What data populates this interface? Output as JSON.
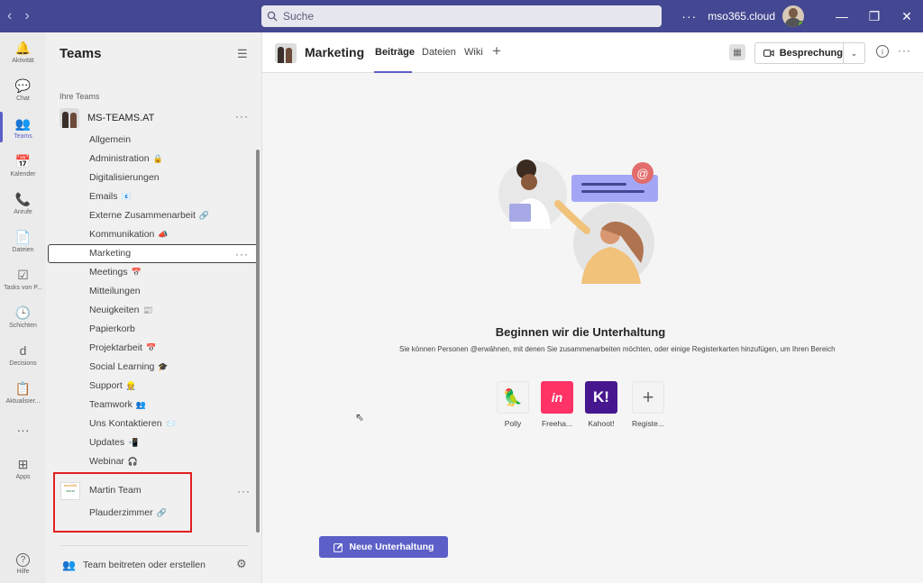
{
  "titlebar": {
    "search_placeholder": "Suche",
    "more": "···",
    "tenant": "mso365.cloud",
    "minimize": "—",
    "maximize": "❐",
    "close": "✕"
  },
  "apprail": {
    "items": [
      {
        "label": "Aktivität",
        "icon": "bell-icon",
        "glyph": "🔔"
      },
      {
        "label": "Chat",
        "icon": "chat-icon",
        "glyph": "💬"
      },
      {
        "label": "Teams",
        "icon": "teams-icon",
        "glyph": "👥"
      },
      {
        "label": "Kalender",
        "icon": "calendar-icon",
        "glyph": "📅"
      },
      {
        "label": "Anrufe",
        "icon": "phone-icon",
        "glyph": "📞"
      },
      {
        "label": "Dateien",
        "icon": "file-icon",
        "glyph": "📄"
      },
      {
        "label": "Tasks von P...",
        "icon": "tasks-icon",
        "glyph": "☑"
      },
      {
        "label": "Schichten",
        "icon": "clock-icon",
        "glyph": "🕒"
      },
      {
        "label": "Decisions",
        "icon": "decisions-icon",
        "glyph": "d"
      },
      {
        "label": "Aktualisier...",
        "icon": "updates-icon",
        "glyph": "📋"
      },
      {
        "label": "",
        "icon": "more-apps-icon",
        "glyph": "···"
      },
      {
        "label": "Apps",
        "icon": "apps-icon",
        "glyph": "⊞"
      },
      {
        "label": "Hilfe",
        "icon": "help-icon",
        "glyph": "?"
      }
    ]
  },
  "sidebar": {
    "title": "Teams",
    "section_label": "Ihre Teams",
    "team1": {
      "name": "MS-TEAMS.AT",
      "channels": [
        {
          "name": "Allgemein",
          "emoji": ""
        },
        {
          "name": "Administration",
          "emoji": "🔒"
        },
        {
          "name": "Digitalisierungen",
          "emoji": ""
        },
        {
          "name": "Emails",
          "emoji": "📧"
        },
        {
          "name": "Externe Zusammenarbeit",
          "emoji": "🔗"
        },
        {
          "name": "Kommunikation",
          "emoji": "📣"
        },
        {
          "name": "Marketing",
          "emoji": ""
        },
        {
          "name": "Meetings",
          "emoji": "📅"
        },
        {
          "name": "Mitteilungen",
          "emoji": ""
        },
        {
          "name": "Neuigkeiten",
          "emoji": "📰"
        },
        {
          "name": "Papierkorb",
          "emoji": ""
        },
        {
          "name": "Projektarbeit",
          "emoji": "📅"
        },
        {
          "name": "Social Learning",
          "emoji": "🎓"
        },
        {
          "name": "Support",
          "emoji": "👷"
        },
        {
          "name": "Teamwork",
          "emoji": "👥"
        },
        {
          "name": "Uns Kontaktieren",
          "emoji": "📨"
        },
        {
          "name": "Updates",
          "emoji": "📲"
        },
        {
          "name": "Webinar",
          "emoji": "🎧"
        }
      ]
    },
    "team2": {
      "name": "Martin Team",
      "avatar_line1": "mso365",
      "avatar_line2": "cloud",
      "channels": [
        {
          "name": "Plauderzimmer",
          "emoji": "🔗"
        }
      ]
    },
    "join_label": "Team beitreten oder erstellen"
  },
  "main": {
    "channel_title": "Marketing",
    "tabs": [
      "Beiträge",
      "Dateien",
      "Wiki"
    ],
    "meeting_label": "Besprechung",
    "empty_title": "Beginnen wir die Unterhaltung",
    "empty_subtitle": "Sie können Personen @erwähnen, mit denen Sie zusammenarbeiten möchten, oder einige Registerkarten hinzufügen, um Ihren Bereich",
    "apps": [
      {
        "label": "Polly",
        "icon": "polly-icon",
        "glyph": "🦜",
        "color": "#f3f3f3"
      },
      {
        "label": "Freeha...",
        "icon": "freehand-icon",
        "glyph": "in",
        "color": "#ff3366"
      },
      {
        "label": "Kahoot!",
        "icon": "kahoot-icon",
        "glyph": "K!",
        "color": "#46178f"
      },
      {
        "label": "Registe...",
        "icon": "add-tab-icon",
        "glyph": "+",
        "color": "#f3f3f3"
      }
    ],
    "new_conversation_label": "Neue Unterhaltung"
  },
  "colors": {
    "titlebar": "#444791",
    "accent": "#5b5fc7",
    "highlight_box": "#e02020"
  }
}
